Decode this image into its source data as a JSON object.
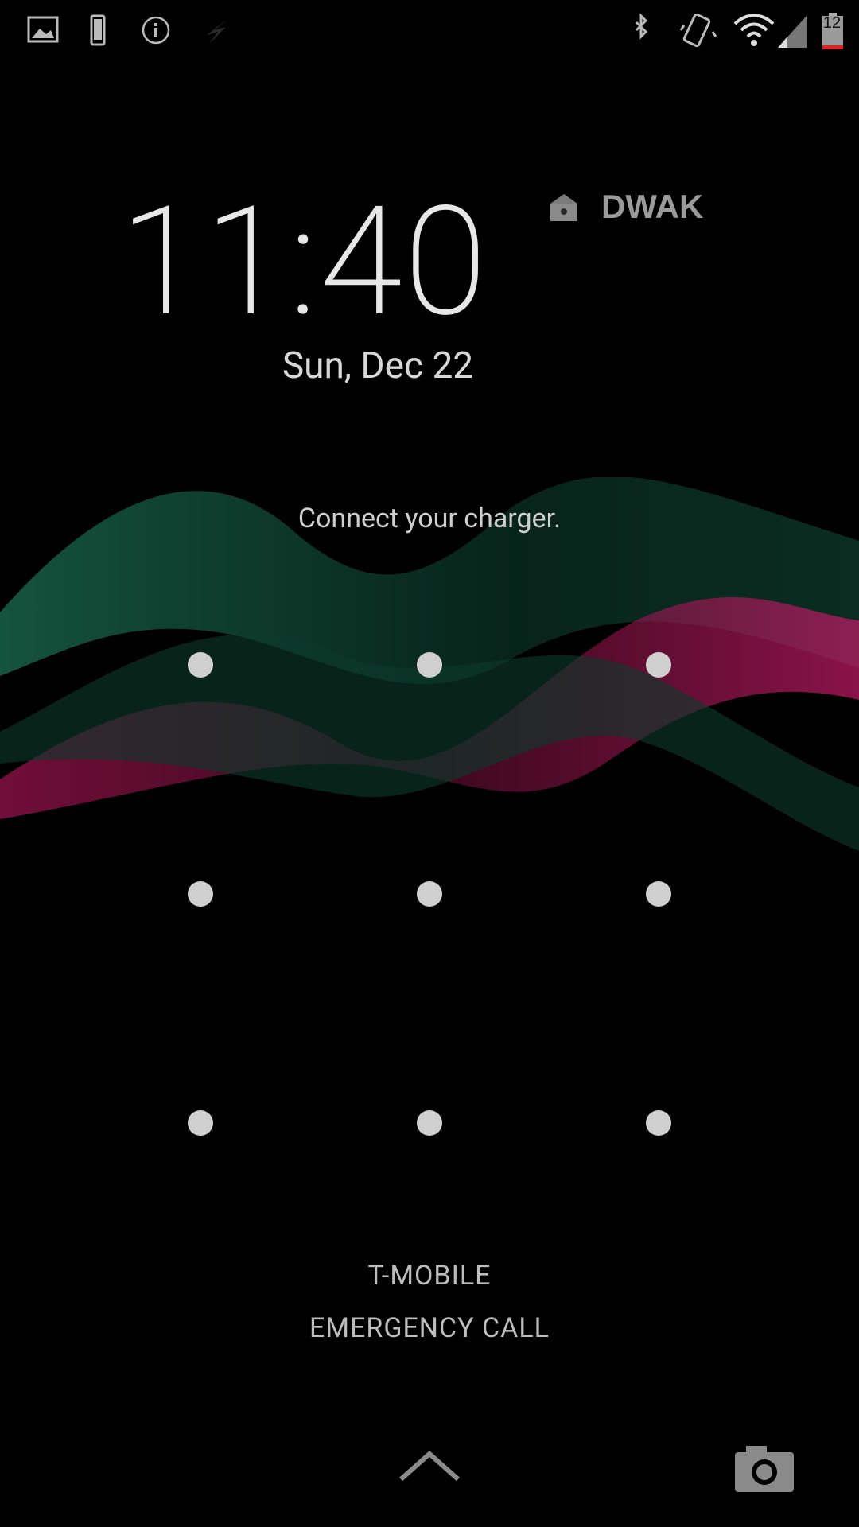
{
  "status_bar": {
    "icons": [
      "image-icon",
      "phone-icon",
      "info-icon",
      "bolt-icon",
      "bluetooth-icon",
      "vibrate-icon",
      "wifi-icon",
      "cell-signal-icon",
      "battery-icon"
    ],
    "battery_level": "12"
  },
  "lock_screen": {
    "time": "11:40",
    "date": "Sun, Dec 22",
    "widget_label": "DWAK",
    "message": "Connect your charger.",
    "carrier": "T-MOBILE",
    "emergency": "EMERGENCY CALL"
  },
  "colors": {
    "background": "#000000",
    "wave_green": "#1f7a5a",
    "wave_magenta": "#b0165b",
    "text": "#e6e6e6",
    "icon_gray": "#9b9b9b"
  }
}
